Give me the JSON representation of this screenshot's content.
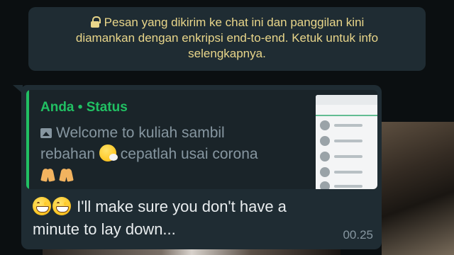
{
  "encryption_notice": {
    "line1": "Pesan yang dikirim ke chat ini dan panggilan kini",
    "line2": "diamankan dengan enkripsi end-to-end. Ketuk untuk info",
    "line3": "selengkapnya.",
    "icon": "lock-icon"
  },
  "message": {
    "quote": {
      "author": "Anda • Status",
      "icon": "image-icon",
      "text_line1": "Welcome to kuliah sambil",
      "text_line2": "rebahan",
      "text_line2b": "cepatlah usai corona"
    },
    "text_line1": "I'll make sure you don't have a",
    "text_line2": "minute to lay down...",
    "time": "00.25"
  },
  "colors": {
    "bubble": "#1f2c33",
    "accent_green": "#21c063",
    "notice_text": "#e9d68a",
    "primary_text": "#e9edef",
    "secondary_text": "#8696a0"
  }
}
